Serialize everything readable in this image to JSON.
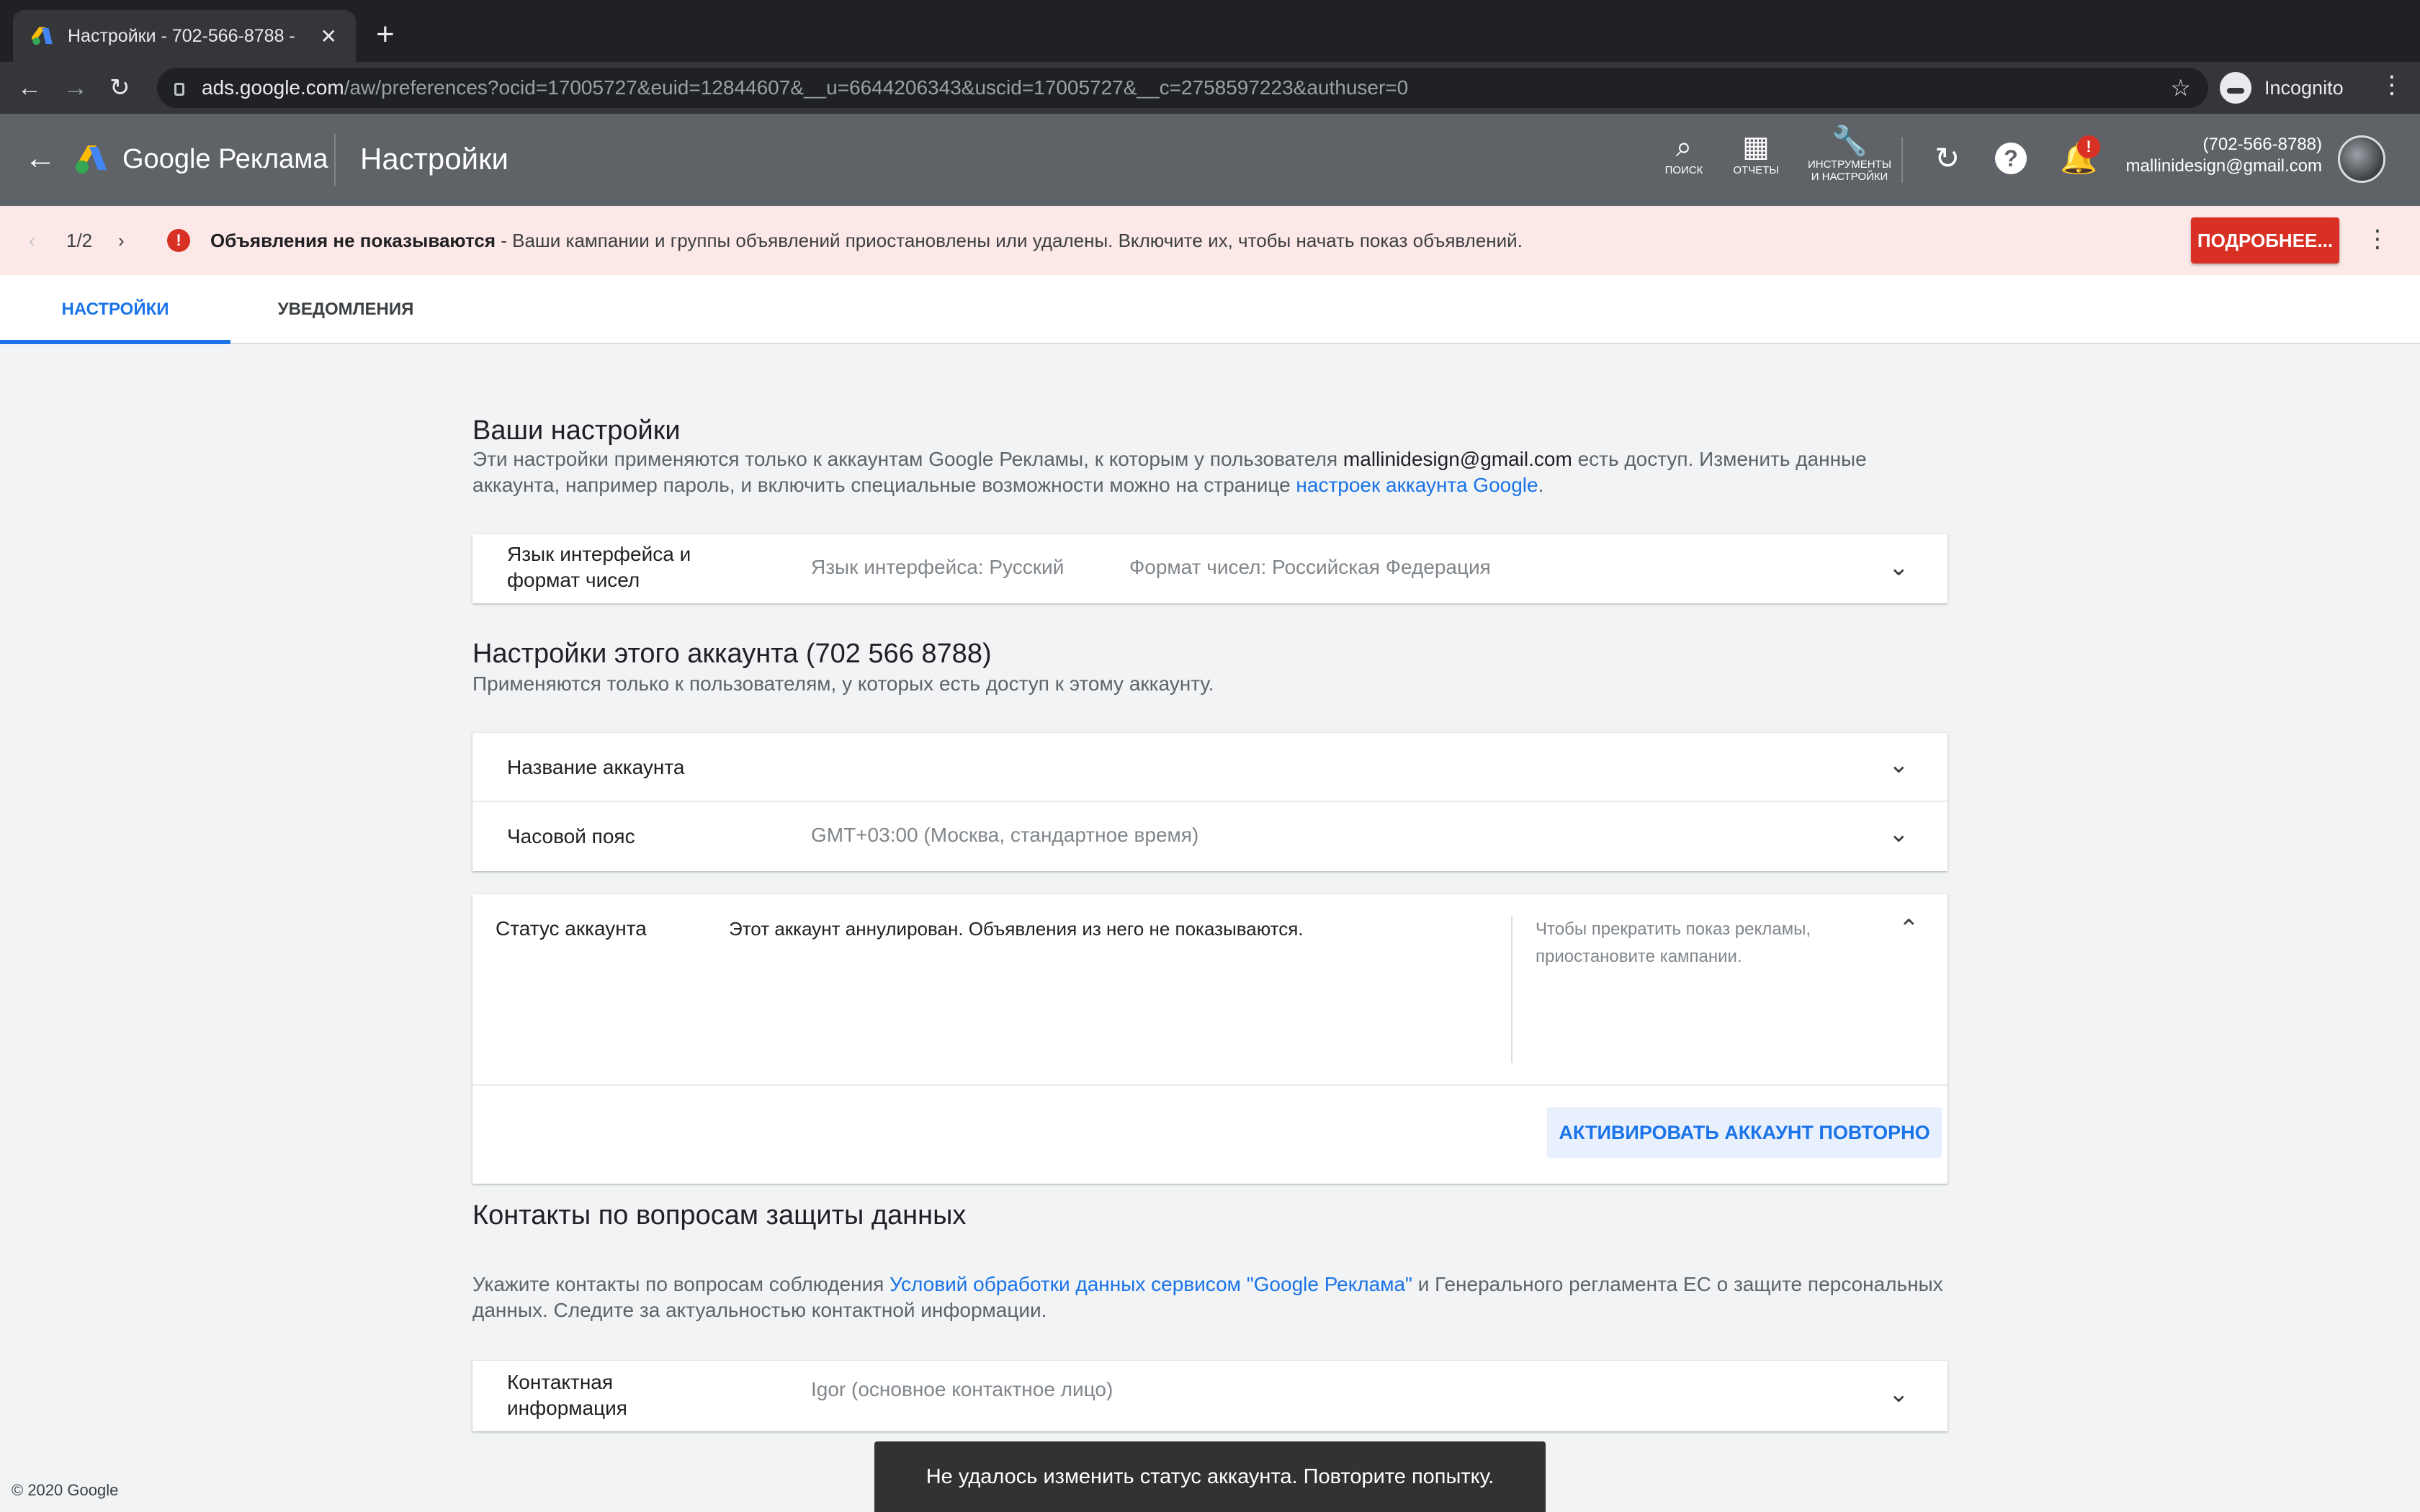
{
  "browser": {
    "tab_title": "Настройки - 702-566-8788 -",
    "tab_close": "✕",
    "new_tab": "+",
    "url_host": "ads.google.com",
    "url_path": "/aw/preferences?ocid=17005727&euid=12844607&__u=6644206343&uscid=17005727&__c=2758597223&authuser=0",
    "profile_label": "Incognito"
  },
  "header": {
    "brand": "Google Реклама",
    "page_title": "Настройки",
    "tools": [
      {
        "label": "ПОИСК",
        "icon": "search-icon"
      },
      {
        "label": "ОТЧЕТЫ",
        "icon": "reports-icon"
      },
      {
        "label": "ИНСТРУМЕНТЫ И НАСТРОЙКИ",
        "line1": "ИНСТРУМЕНТЫ",
        "line2": "И НАСТРОЙКИ",
        "icon": "wrench-icon"
      }
    ],
    "notification_badge": "!",
    "account_phone": "(702-566-8788)",
    "account_email": "mallinidesign@gmail.com"
  },
  "alert": {
    "pager": "1/2",
    "title": "Объявления не показываются",
    "message": " - Ваши кампании и группы объявлений приостановлены или удалены. Включите их, чтобы начать показ объявлений.",
    "button_label": "ПОДРОБНЕЕ...",
    "color": "#d93025"
  },
  "subtabs": [
    {
      "label": "НАСТРОЙКИ",
      "active": true
    },
    {
      "label": "УВЕДОМЛЕНИЯ",
      "active": false
    }
  ],
  "your_settings": {
    "title": "Ваши настройки",
    "desc_part1": "Эти настройки применяются только к аккаунтам Google Рекламы, к которым у пользователя ",
    "desc_email": "mallinidesign@gmail.com",
    "desc_part2": " есть доступ. Изменить данные аккаунта, например пароль, и включить специальные возможности можно на странице ",
    "desc_link": "настроек аккаунта Google",
    "desc_end": ".",
    "rows": [
      {
        "label_line1": "Язык интерфейса и",
        "label_line2": "формат чисел",
        "value1": "Язык интерфейса: Русский",
        "value2": "Формат чисел: Российская Федерация"
      }
    ]
  },
  "account_settings": {
    "title": "Настройки этого аккаунта (702 566 8788)",
    "desc": "Применяются только к пользователям, у которых есть доступ к этому аккаунту.",
    "rows": [
      {
        "label": "Название аккаунта",
        "value": ""
      },
      {
        "label": "Часовой пояс",
        "value": "GMT+03:00 (Москва, стандартное время)"
      }
    ],
    "status": {
      "label": "Статус аккаунта",
      "message": "Этот аккаунт аннулирован. Объявления из него не показываются.",
      "hint": "Чтобы прекратить показ рекламы, приостановите кампании.",
      "button_label": "АКТИВИРОВАТЬ АККАУНТ ПОВТОРНО"
    }
  },
  "privacy": {
    "title": "Контакты по вопросам защиты данных",
    "desc_part1": "Укажите контакты по вопросам соблюдения ",
    "desc_link": "Условий обработки данных сервисом \"Google Реклама\"",
    "desc_part2": " и Генерального регламента ЕС о защите персональных данных. Следите за актуальностью контактной информации.",
    "row": {
      "label_line1": "Контактная",
      "label_line2": "информация",
      "value": "Igor (основное контактное лицо)"
    }
  },
  "footer": "© 2020 Google",
  "toast": "Не удалось изменить статус аккаунта. Повторите попытку.",
  "colors": {
    "accent": "#1a73e8",
    "header_bg": "#5f6368",
    "alert_bg": "#fce8e6"
  }
}
